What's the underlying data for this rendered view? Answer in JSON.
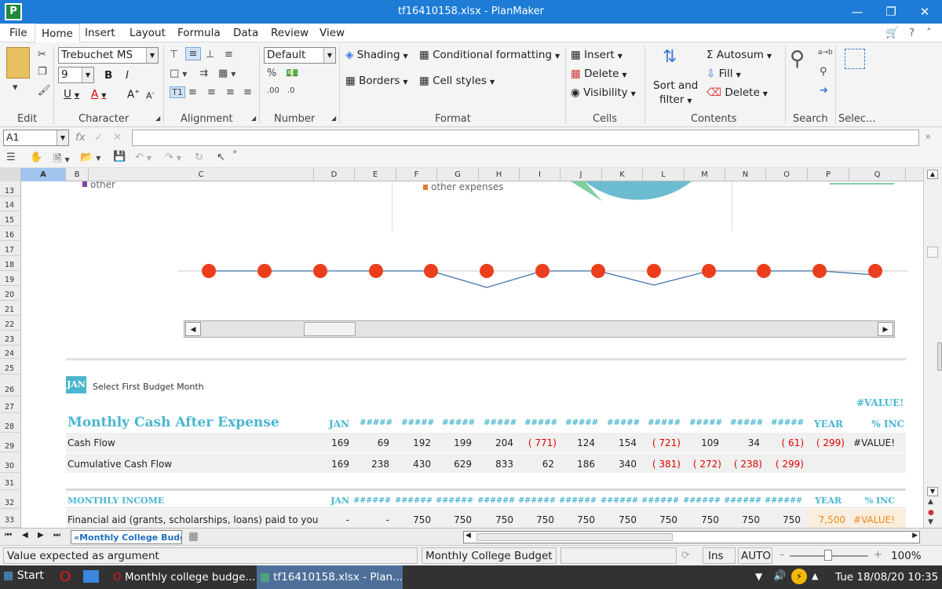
{
  "window": {
    "title": "tf16410158.xlsx - PlanMaker",
    "app_icon": "P"
  },
  "menu": [
    "File",
    "Home",
    "Insert",
    "Layout",
    "Formula",
    "Data",
    "Review",
    "View"
  ],
  "ribbon": {
    "font_name": "Trebuchet MS",
    "font_size": "9",
    "number_format": "Default",
    "format": {
      "shading": "Shading",
      "borders": "Borders",
      "conditional": "Conditional formatting",
      "cell_styles": "Cell styles"
    },
    "cells": {
      "insert": "Insert",
      "delete": "Delete",
      "visibility": "Visibility"
    },
    "sort_filter": {
      "line1": "Sort and",
      "line2": "filter"
    },
    "contents": {
      "autosum": "Autosum",
      "fill": "Fill",
      "delete": "Delete"
    },
    "groups": {
      "edit": "Edit",
      "character": "Character",
      "alignment": "Alignment",
      "number": "Number",
      "format": "Format",
      "cells": "Cells",
      "contents": "Contents",
      "search": "Search",
      "select": "Selec..."
    }
  },
  "formula_bar": {
    "cell_ref": "A1",
    "fx": "fx",
    "content": ""
  },
  "columns": [
    "A",
    "B",
    "C",
    "D",
    "E",
    "F",
    "G",
    "H",
    "I",
    "J",
    "K",
    "L",
    "M",
    "N",
    "O",
    "P",
    "Q"
  ],
  "rows": [
    "13",
    "14",
    "15",
    "16",
    "17",
    "18",
    "19",
    "20",
    "21",
    "22",
    "23",
    "24",
    "25",
    "26",
    "27",
    "28",
    "29",
    "30",
    "31",
    "32",
    "33"
  ],
  "chart_fragments": {
    "legend_left": "other",
    "legend_right": "other expenses"
  },
  "sheet": {
    "month_selector": {
      "value": "JAN",
      "label": "Select First Budget Month"
    },
    "value_error": "#VALUE!",
    "cash": {
      "title": "Monthly Cash After Expense",
      "headers": [
        "JAN",
        "#####",
        "#####",
        "#####",
        "#####",
        "#####",
        "#####",
        "#####",
        "#####",
        "#####",
        "#####",
        "#####"
      ],
      "year": "YEAR",
      "pct": "% INC",
      "cash_flow": {
        "label": "Cash Flow",
        "values": [
          "169",
          "69",
          "192",
          "199",
          "204",
          "( 771)",
          "124",
          "154",
          "( 721)",
          "109",
          "34",
          "( 61)"
        ],
        "year": "( 299)",
        "pct": "#VALUE!"
      },
      "cumulative": {
        "label": "Cumulative Cash Flow",
        "values": [
          "169",
          "238",
          "430",
          "629",
          "833",
          "62",
          "186",
          "340",
          "( 381)",
          "( 272)",
          "( 238)",
          "( 299)"
        ]
      }
    },
    "income": {
      "title": "MONTHLY INCOME",
      "headers": [
        "JAN",
        "######",
        "######",
        "######",
        "######",
        "######",
        "######",
        "######",
        "######",
        "######",
        "######",
        "######"
      ],
      "year": "YEAR",
      "pct": "% INC",
      "financial_aid": {
        "label": "Financial aid (grants, scholarships, loans) paid to you",
        "values": [
          "-",
          "-",
          "750",
          "750",
          "750",
          "750",
          "750",
          "750",
          "750",
          "750",
          "750",
          "750"
        ],
        "year": "7,500",
        "pct": "#VALUE!"
      }
    }
  },
  "sheet_tab": "«Monthly College Budget»",
  "status": {
    "message": "Value expected as argument",
    "sheet_name": "Monthly College Budget",
    "ins": "Ins",
    "auto": "AUTO",
    "zoom": "100%"
  },
  "taskbar": {
    "start": "Start",
    "task1": "Monthly college budge...",
    "task2": "tf16410158.xlsx - Plan...",
    "clock": "Tue 18/08/20 10:35"
  }
}
